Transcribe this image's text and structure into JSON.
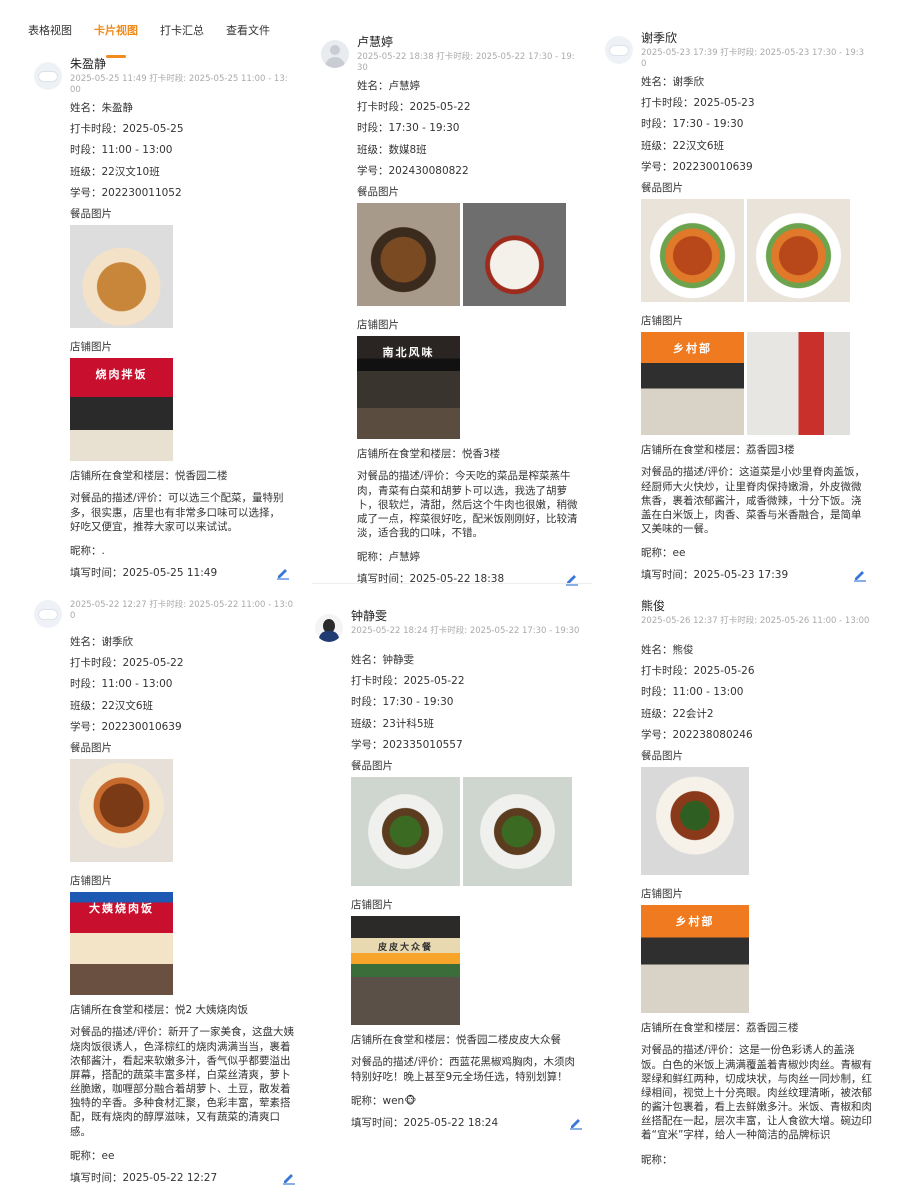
{
  "tabs": [
    "表格视图",
    "卡片视图",
    "打卡汇总",
    "查看文件"
  ],
  "labels": {
    "name": "姓名：",
    "date": "打卡时段：",
    "period": "时段：",
    "class": "班级：",
    "sid": "学号：",
    "food_images": "餐品图片",
    "store_images": "店铺图片",
    "location": "店铺所在食堂和楼层：",
    "review": "对餐品的描述/评价：",
    "nickname": "昵称：",
    "filled_time": "填写时间："
  },
  "cards": [
    {
      "title": "朱盈静",
      "meta": "2025-05-25 11:49 打卡时段: 2025-05-25 11:00 - 13:00",
      "name": "朱盈静",
      "date": "2025-05-25",
      "period": "11:00 - 13:00",
      "class": "22汉文10班",
      "sid": "202230011052",
      "location": "悦香园二楼",
      "review": "可以选三个配菜，量特别多，很实惠，店里也有非常多口味可以选择，好吃又便宜，推荐大家可以来试试。",
      "nickname": ".",
      "filled_time": "2025-05-25 11:49",
      "store_sign": "烧肉拌饭"
    },
    {
      "title": "卢慧婷",
      "meta": "2025-05-22 18:38 打卡时段: 2025-05-22 17:30 - 19:30",
      "name": "卢慧婷",
      "date": "2025-05-22",
      "period": "17:30 - 19:30",
      "class": "数媒8班",
      "sid": "202430080822",
      "location": "悦香3楼",
      "review": "今天吃的菜品是榨菜蒸牛肉，青菜有白菜和胡萝卜可以选，我选了胡萝卜，很软烂，清甜，然后这个牛肉也很嫩，稍微咸了一点，榨菜很好吃，配米饭刚刚好，比较清淡，适合我的口味，不错。",
      "nickname": "卢慧婷",
      "filled_time": "2025-05-22 18:38",
      "store_sign": "南北风味"
    },
    {
      "title": "谢季欣",
      "meta": "2025-05-23 17:39 打卡时段: 2025-05-23 17:30 - 19:30",
      "name": "谢季欣",
      "date": "2025-05-23",
      "period": "17:30 - 19:30",
      "class": "22汉文6班",
      "sid": "202230010639",
      "location": "荔香园3楼",
      "review": "这道菜是小炒里脊肉盖饭，经厨师大火快炒，让里脊肉保持嫩滑，外皮微微焦香，裹着浓郁酱汁，咸香微辣，十分下饭。浇盖在白米饭上，肉香、菜香与米香融合，是简单又美味的一餐。",
      "nickname": "ee",
      "filled_time": "2025-05-23 17:39",
      "store_sign": "乡村部"
    },
    {
      "title": "",
      "meta": "2025-05-22 12:27 打卡时段: 2025-05-22 11:00 - 13:00",
      "name": "谢季欣",
      "date": "2025-05-22",
      "period": "11:00 - 13:00",
      "class": "22汉文6班",
      "sid": "202230010639",
      "location": "悦2 大姨烧肉饭",
      "review": "新开了一家美食，这盘大姨烧肉饭很诱人，色泽棕红的烧肉满满当当，裹着浓郁酱汁，看起来软嫩多汁，香气似乎都要溢出屏幕，搭配的蔬菜丰富多样，白菜丝清爽，萝卜丝脆嫩，咖喱部分融合着胡萝卜、土豆，散发着独特的辛香。多种食材汇聚，色彩丰富，荤素搭配，既有烧肉的醇厚滋味，又有蔬菜的清爽口感。",
      "nickname": "ee",
      "filled_time": "2025-05-22 12:27",
      "store_sign": "大姨烧肉饭"
    },
    {
      "title": "钟静雯",
      "meta": "2025-05-22 18:24 打卡时段: 2025-05-22 17:30 - 19:30",
      "name": "钟静雯",
      "date": "2025-05-22",
      "period": "17:30 - 19:30",
      "class": "23计科5班",
      "sid": "202335010557",
      "location": "悦香园二楼皮皮大众餐",
      "review": "西蓝花黑椒鸡胸肉，木须肉特别好吃！晚上甚至9元全场任选，特别划算！",
      "nickname": "wen🐵",
      "filled_time": "2025-05-22 18:24",
      "store_sign": "皮皮大众餐"
    },
    {
      "title": "熊俊",
      "meta": "2025-05-26 12:37 打卡时段: 2025-05-26 11:00 - 13:00",
      "name": "熊俊",
      "date": "2025-05-26",
      "period": "11:00 - 13:00",
      "class": "22会计2",
      "sid": "202238080246",
      "location": "荔香园三楼",
      "review": "这是一份色彩诱人的盖浇饭。白色的米饭上满满覆盖着青椒炒肉丝。青椒有翠绿和鲜红两种，切成块状，与肉丝一同炒制，红绿相间，视觉上十分亮眼。肉丝纹理清晰，被浓郁的酱汁包裹着，看上去鲜嫩多汁。米饭、青椒和肉丝搭配在一起，层次丰富，让人食欲大增。碗边印着“宜米”字样，给人一种简洁的品牌标识",
      "nickname": "",
      "filled_time": "",
      "store_sign": "乡村部"
    }
  ]
}
